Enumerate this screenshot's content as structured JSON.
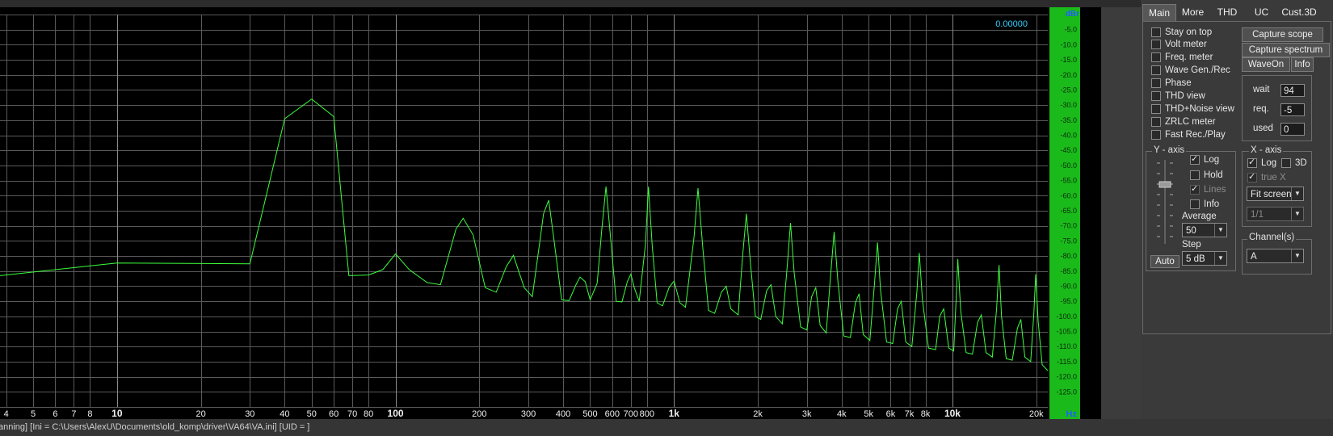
{
  "plot": {
    "value_readout": "0.00000",
    "y_unit": "dBr",
    "x_unit": "Hz",
    "y_ticks": [
      "-5.0",
      "-10.0",
      "-15.0",
      "-20.0",
      "-25.0",
      "-30.0",
      "-35.0",
      "-40.0",
      "-45.0",
      "-50.0",
      "-55.0",
      "-60.0",
      "-65.0",
      "-70.0",
      "-75.0",
      "-80.0",
      "-85.0",
      "-90.0",
      "-95.0",
      "-100.0",
      "-105.0",
      "-110.0",
      "-115.0",
      "-120.0",
      "-125.0"
    ],
    "x_ticks": [
      {
        "f": 4,
        "label": "4",
        "bold": false
      },
      {
        "f": 5,
        "label": "5",
        "bold": false
      },
      {
        "f": 6,
        "label": "6",
        "bold": false
      },
      {
        "f": 7,
        "label": "7",
        "bold": false
      },
      {
        "f": 8,
        "label": "8",
        "bold": false
      },
      {
        "f": 10,
        "label": "10",
        "bold": true
      },
      {
        "f": 20,
        "label": "20",
        "bold": false
      },
      {
        "f": 30,
        "label": "30",
        "bold": false
      },
      {
        "f": 40,
        "label": "40",
        "bold": false
      },
      {
        "f": 50,
        "label": "50",
        "bold": false
      },
      {
        "f": 60,
        "label": "60",
        "bold": false
      },
      {
        "f": 70,
        "label": "70",
        "bold": false
      },
      {
        "f": 80,
        "label": "80",
        "bold": false
      },
      {
        "f": 100,
        "label": "100",
        "bold": true
      },
      {
        "f": 200,
        "label": "200",
        "bold": false
      },
      {
        "f": 300,
        "label": "300",
        "bold": false
      },
      {
        "f": 400,
        "label": "400",
        "bold": false
      },
      {
        "f": 500,
        "label": "500",
        "bold": false
      },
      {
        "f": 600,
        "label": "600",
        "bold": false
      },
      {
        "f": 700,
        "label": "700",
        "bold": false
      },
      {
        "f": 800,
        "label": "800",
        "bold": false
      },
      {
        "f": 1000,
        "label": "1k",
        "bold": true
      },
      {
        "f": 2000,
        "label": "2k",
        "bold": false
      },
      {
        "f": 3000,
        "label": "3k",
        "bold": false
      },
      {
        "f": 4000,
        "label": "4k",
        "bold": false
      },
      {
        "f": 5000,
        "label": "5k",
        "bold": false
      },
      {
        "f": 6000,
        "label": "6k",
        "bold": false
      },
      {
        "f": 7000,
        "label": "7k",
        "bold": false
      },
      {
        "f": 8000,
        "label": "8k",
        "bold": false
      },
      {
        "f": 10000,
        "label": "10k",
        "bold": true
      },
      {
        "f": 20000,
        "label": "20k",
        "bold": false
      }
    ]
  },
  "chart_data": {
    "type": "line",
    "xscale": "log",
    "xlim": [
      3.8,
      22000
    ],
    "ylim": [
      -130,
      0
    ],
    "series": [
      {
        "color": "#3cff3c",
        "points": [
          [
            3.8,
            -86.5
          ],
          [
            10,
            -82.3
          ],
          [
            30,
            -82.6
          ],
          [
            40,
            -34.5
          ],
          [
            50,
            -28.0
          ],
          [
            60,
            -33.8
          ],
          [
            68,
            -86.5
          ],
          [
            80,
            -86.3
          ],
          [
            90,
            -84.5
          ],
          [
            100,
            -79.3
          ],
          [
            112,
            -84.5
          ],
          [
            130,
            -88.8
          ],
          [
            145,
            -89.5
          ],
          [
            165,
            -71.0
          ],
          [
            175,
            -67.5
          ],
          [
            190,
            -73.0
          ],
          [
            210,
            -90.5
          ],
          [
            230,
            -92.0
          ],
          [
            250,
            -83.5
          ],
          [
            265,
            -79.8
          ],
          [
            290,
            -90.5
          ],
          [
            310,
            -93.5
          ],
          [
            330,
            -75.0
          ],
          [
            340,
            -66.0
          ],
          [
            355,
            -61.5
          ],
          [
            370,
            -74.0
          ],
          [
            395,
            -94.5
          ],
          [
            420,
            -94.8
          ],
          [
            445,
            -89.5
          ],
          [
            460,
            -87.0
          ],
          [
            480,
            -88.5
          ],
          [
            500,
            -94.5
          ],
          [
            530,
            -89.0
          ],
          [
            550,
            -71.5
          ],
          [
            570,
            -57.0
          ],
          [
            590,
            -72.5
          ],
          [
            620,
            -95.0
          ],
          [
            650,
            -95.2
          ],
          [
            680,
            -88.5
          ],
          [
            700,
            -86.0
          ],
          [
            720,
            -90.5
          ],
          [
            750,
            -95.0
          ],
          [
            790,
            -76.0
          ],
          [
            810,
            -57.0
          ],
          [
            835,
            -76.5
          ],
          [
            870,
            -95.5
          ],
          [
            910,
            -96.5
          ],
          [
            960,
            -90.5
          ],
          [
            1000,
            -88.3
          ],
          [
            1050,
            -95.5
          ],
          [
            1100,
            -97.0
          ],
          [
            1180,
            -74.0
          ],
          [
            1220,
            -57.5
          ],
          [
            1270,
            -77.5
          ],
          [
            1330,
            -98.0
          ],
          [
            1400,
            -99.0
          ],
          [
            1480,
            -92.0
          ],
          [
            1540,
            -90.0
          ],
          [
            1600,
            -97.5
          ],
          [
            1700,
            -99.5
          ],
          [
            1770,
            -78.5
          ],
          [
            1820,
            -66.0
          ],
          [
            1880,
            -82.0
          ],
          [
            1960,
            -100.0
          ],
          [
            2050,
            -101.0
          ],
          [
            2150,
            -91.5
          ],
          [
            2230,
            -89.5
          ],
          [
            2320,
            -100.0
          ],
          [
            2450,
            -102.5
          ],
          [
            2550,
            -83.5
          ],
          [
            2620,
            -69.0
          ],
          [
            2700,
            -85.5
          ],
          [
            2850,
            -103.5
          ],
          [
            3000,
            -104.5
          ],
          [
            3120,
            -93.5
          ],
          [
            3230,
            -90.5
          ],
          [
            3350,
            -103.0
          ],
          [
            3520,
            -105.5
          ],
          [
            3650,
            -86.5
          ],
          [
            3760,
            -72.0
          ],
          [
            3880,
            -88.5
          ],
          [
            4070,
            -106.5
          ],
          [
            4300,
            -107.0
          ],
          [
            4480,
            -95.5
          ],
          [
            4620,
            -92.5
          ],
          [
            4780,
            -106.0
          ],
          [
            5050,
            -108.0
          ],
          [
            5250,
            -89.0
          ],
          [
            5380,
            -75.5
          ],
          [
            5520,
            -91.5
          ],
          [
            5800,
            -108.5
          ],
          [
            6100,
            -109.0
          ],
          [
            6350,
            -97.5
          ],
          [
            6550,
            -95.0
          ],
          [
            6800,
            -108.5
          ],
          [
            7150,
            -110.0
          ],
          [
            7450,
            -92.0
          ],
          [
            7600,
            -79.0
          ],
          [
            7800,
            -94.5
          ],
          [
            8200,
            -110.5
          ],
          [
            8700,
            -111.0
          ],
          [
            9000,
            -100.0
          ],
          [
            9300,
            -97.5
          ],
          [
            9700,
            -110.5
          ],
          [
            10100,
            -111.5
          ],
          [
            10300,
            -95.0
          ],
          [
            10450,
            -81.0
          ],
          [
            10700,
            -98.0
          ],
          [
            11200,
            -112.0
          ],
          [
            11800,
            -112.5
          ],
          [
            12300,
            -102.0
          ],
          [
            12700,
            -99.5
          ],
          [
            13200,
            -112.0
          ],
          [
            13900,
            -113.5
          ],
          [
            14400,
            -97.5
          ],
          [
            14700,
            -83.0
          ],
          [
            15000,
            -100.0
          ],
          [
            15600,
            -114.0
          ],
          [
            16400,
            -114.5
          ],
          [
            17100,
            -104.0
          ],
          [
            17600,
            -101.0
          ],
          [
            18200,
            -113.5
          ],
          [
            19100,
            -115.0
          ],
          [
            19600,
            -99.0
          ],
          [
            19900,
            -86.0
          ],
          [
            20300,
            -101.5
          ],
          [
            21000,
            -116.0
          ],
          [
            22000,
            -118.0
          ]
        ]
      }
    ]
  },
  "tabs": [
    "Main",
    "More",
    "THD",
    "UC",
    "Cust.3D"
  ],
  "options": [
    {
      "label": "Stay on top",
      "checked": false
    },
    {
      "label": "Volt meter",
      "checked": false
    },
    {
      "label": "Freq. meter",
      "checked": false
    },
    {
      "label": "Wave Gen./Rec",
      "checked": false
    },
    {
      "label": "Phase",
      "checked": false
    },
    {
      "label": "THD view",
      "checked": false
    },
    {
      "label": "THD+Noise view",
      "checked": false
    },
    {
      "label": "ZRLC meter",
      "checked": false
    },
    {
      "label": "Fast Rec./Play",
      "checked": false
    }
  ],
  "buttons": {
    "capture_scope": "Capture scope",
    "capture_spectrum": "Capture spectrum",
    "waveon": "WaveOn",
    "info": "Info",
    "auto": "Auto"
  },
  "buffer": {
    "wait_label": "wait",
    "wait_value": "94",
    "req_label": "req.",
    "req_value": "-5",
    "used_label": "used",
    "used_value": "0"
  },
  "y_axis": {
    "title": "Y - axis",
    "log": {
      "label": "Log",
      "checked": true
    },
    "hold": {
      "label": "Hold",
      "checked": false
    },
    "lines": {
      "label": "Lines",
      "checked": true,
      "disabled": true
    },
    "info": {
      "label": "Info",
      "checked": false
    },
    "average_label": "Average",
    "average_value": "50",
    "step_label": "Step",
    "step_value": "5 dB"
  },
  "x_axis": {
    "title": "X - axis",
    "log": {
      "label": "Log",
      "checked": true
    },
    "threed": {
      "label": "3D",
      "checked": false
    },
    "truex": {
      "label": "true X",
      "checked": true,
      "disabled": true
    },
    "fit_value": "Fit screen",
    "ratio_value": "1/1"
  },
  "channels": {
    "title": "Channel(s)",
    "value": "A"
  },
  "status": "anning]  [Ini = C:\\Users\\AlexU\\Documents\\old_komp\\driver\\VA64\\VA.ini]  [UID = ]"
}
